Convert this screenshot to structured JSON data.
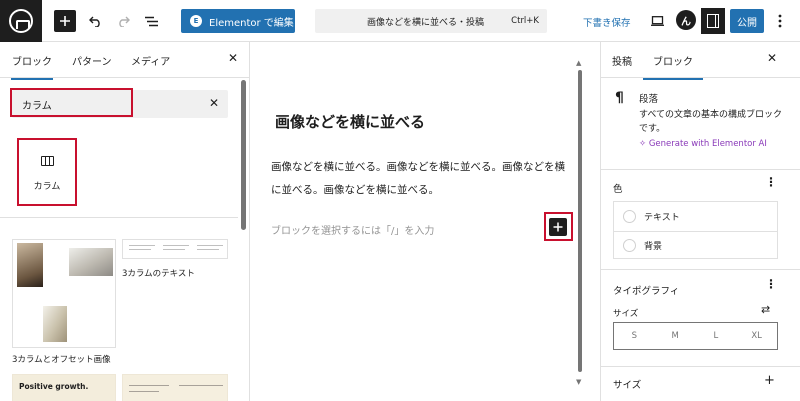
{
  "topbar": {
    "command_title": "画像などを横に並べる・投稿",
    "command_shortcut": "Ctrl+K",
    "elementor_label": "Elementor で編集",
    "elementor_badge": "E",
    "draft_label": "下書き保存",
    "publish_label": "公開",
    "avatar_letter": "ん"
  },
  "inserter": {
    "tabs": [
      "ブロック",
      "パターン",
      "メディア"
    ],
    "search_value": "カラム",
    "results": [
      {
        "label": "カラム",
        "icon": "columns-icon"
      }
    ],
    "patterns": [
      {
        "label": "3カラムとオフセット画像"
      },
      {
        "label": "3カラムのテキスト"
      },
      {
        "label": "Positive growth."
      },
      {
        "label": ""
      }
    ]
  },
  "canvas": {
    "title": "画像などを横に並べる",
    "paragraph": "画像などを横に並べる。画像などを横に並べる。画像などを横に並べる。画像などを横に並べる。",
    "placeholder": "ブロックを選択するには「/」を入力"
  },
  "settings": {
    "tabs": [
      "投稿",
      "ブロック"
    ],
    "block_name": "段落",
    "block_description": "すべての文章の基本の構成ブロックです。",
    "generate_ai": "Generate with Elementor AI",
    "color_title": "色",
    "color_items": [
      "テキスト",
      "背景"
    ],
    "typography_title": "タイポグラフィ",
    "size_label": "サイズ",
    "size_options": [
      "S",
      "M",
      "L",
      "XL"
    ],
    "dimensions_title": "サイズ"
  },
  "colors": {
    "accent": "#2271b1",
    "highlight_border": "#c8102e",
    "ai_purple": "#8a3ab9"
  }
}
